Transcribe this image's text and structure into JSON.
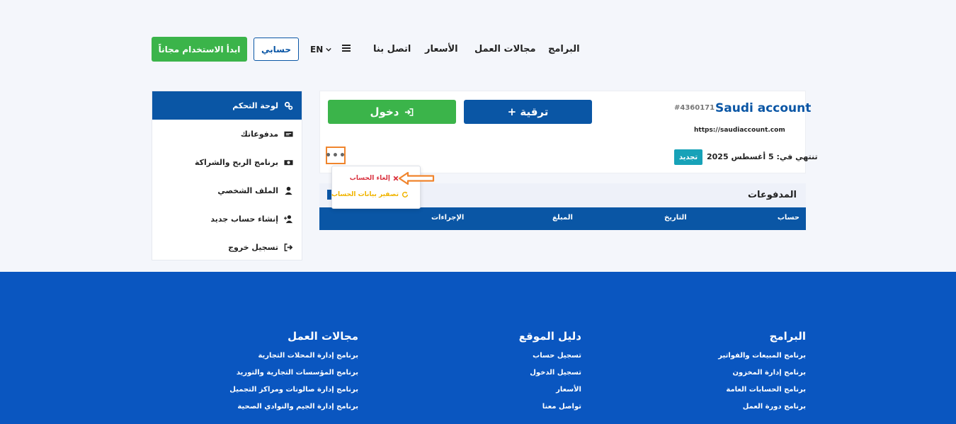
{
  "header": {
    "cta_label": "ابدأ الاستخدام مجاناً",
    "account_label": "حسابي",
    "lang_label": "EN",
    "nav": [
      {
        "id": "programs",
        "label": "البرامج"
      },
      {
        "id": "fields",
        "label": "مجالات العمل"
      },
      {
        "id": "prices",
        "label": "الأسعار"
      },
      {
        "id": "contact",
        "label": "اتصل بنا"
      }
    ]
  },
  "sidebar": {
    "dashboard": "لوحة التحكم",
    "items": [
      {
        "label": "مدفوعاتك",
        "icon": "money-icon"
      },
      {
        "label": "برنامج الربح والشراكة",
        "icon": "cash-icon"
      },
      {
        "label": "الملف الشخصي",
        "icon": "user-icon"
      },
      {
        "label": "إنشاء حساب جديد",
        "icon": "user-plus-icon"
      },
      {
        "label": "تسجيل خروج",
        "icon": "sign-out-icon"
      }
    ]
  },
  "account": {
    "name": "Saudi account",
    "id": "#4360171",
    "url": "https://saudiaccount.com",
    "expiry": "تنتهي في: 5 أغسطس 2025",
    "renew_label": "تجديد",
    "upgrade_label": "+ ترقية",
    "login_label": "دخول",
    "more_label": "•••"
  },
  "dropdown": {
    "cancel_label": "إلغاء الحساب",
    "reset_label": "تصفير بيانات الحساب"
  },
  "payments": {
    "title": "المدفوعات",
    "columns": [
      "حساب",
      "التاريخ",
      "المبلغ",
      "الإجراءات"
    ]
  },
  "footer": {
    "columns": [
      {
        "title": "البرامج",
        "links": [
          "برنامج المبيعات والفواتير",
          "برنامج إدارة المخزون",
          "برنامج الحسابات العامة",
          "برنامج دورة العمل"
        ]
      },
      {
        "title": "دليل الموقع",
        "links": [
          "تسجيل حساب",
          "تسجيل الدخول",
          "الأسعار",
          "تواصل معنا"
        ]
      },
      {
        "title": "مجالات العمل",
        "links": [
          "برنامج إدارة المحلات التجارية",
          "برنامج المؤسسات التجارية والتوريد",
          "برنامج إدارة صالونات ومراكز التجميل",
          "برنامج إدارة الجيم والنوادي الصحية"
        ]
      }
    ]
  },
  "colors": {
    "primary": "#0a56a5",
    "success": "#3bb44a",
    "info": "#17a2b8",
    "danger": "#d9303e",
    "warning": "#f0b400",
    "annotation": "#f0852d",
    "footer": "#0a56c0"
  }
}
